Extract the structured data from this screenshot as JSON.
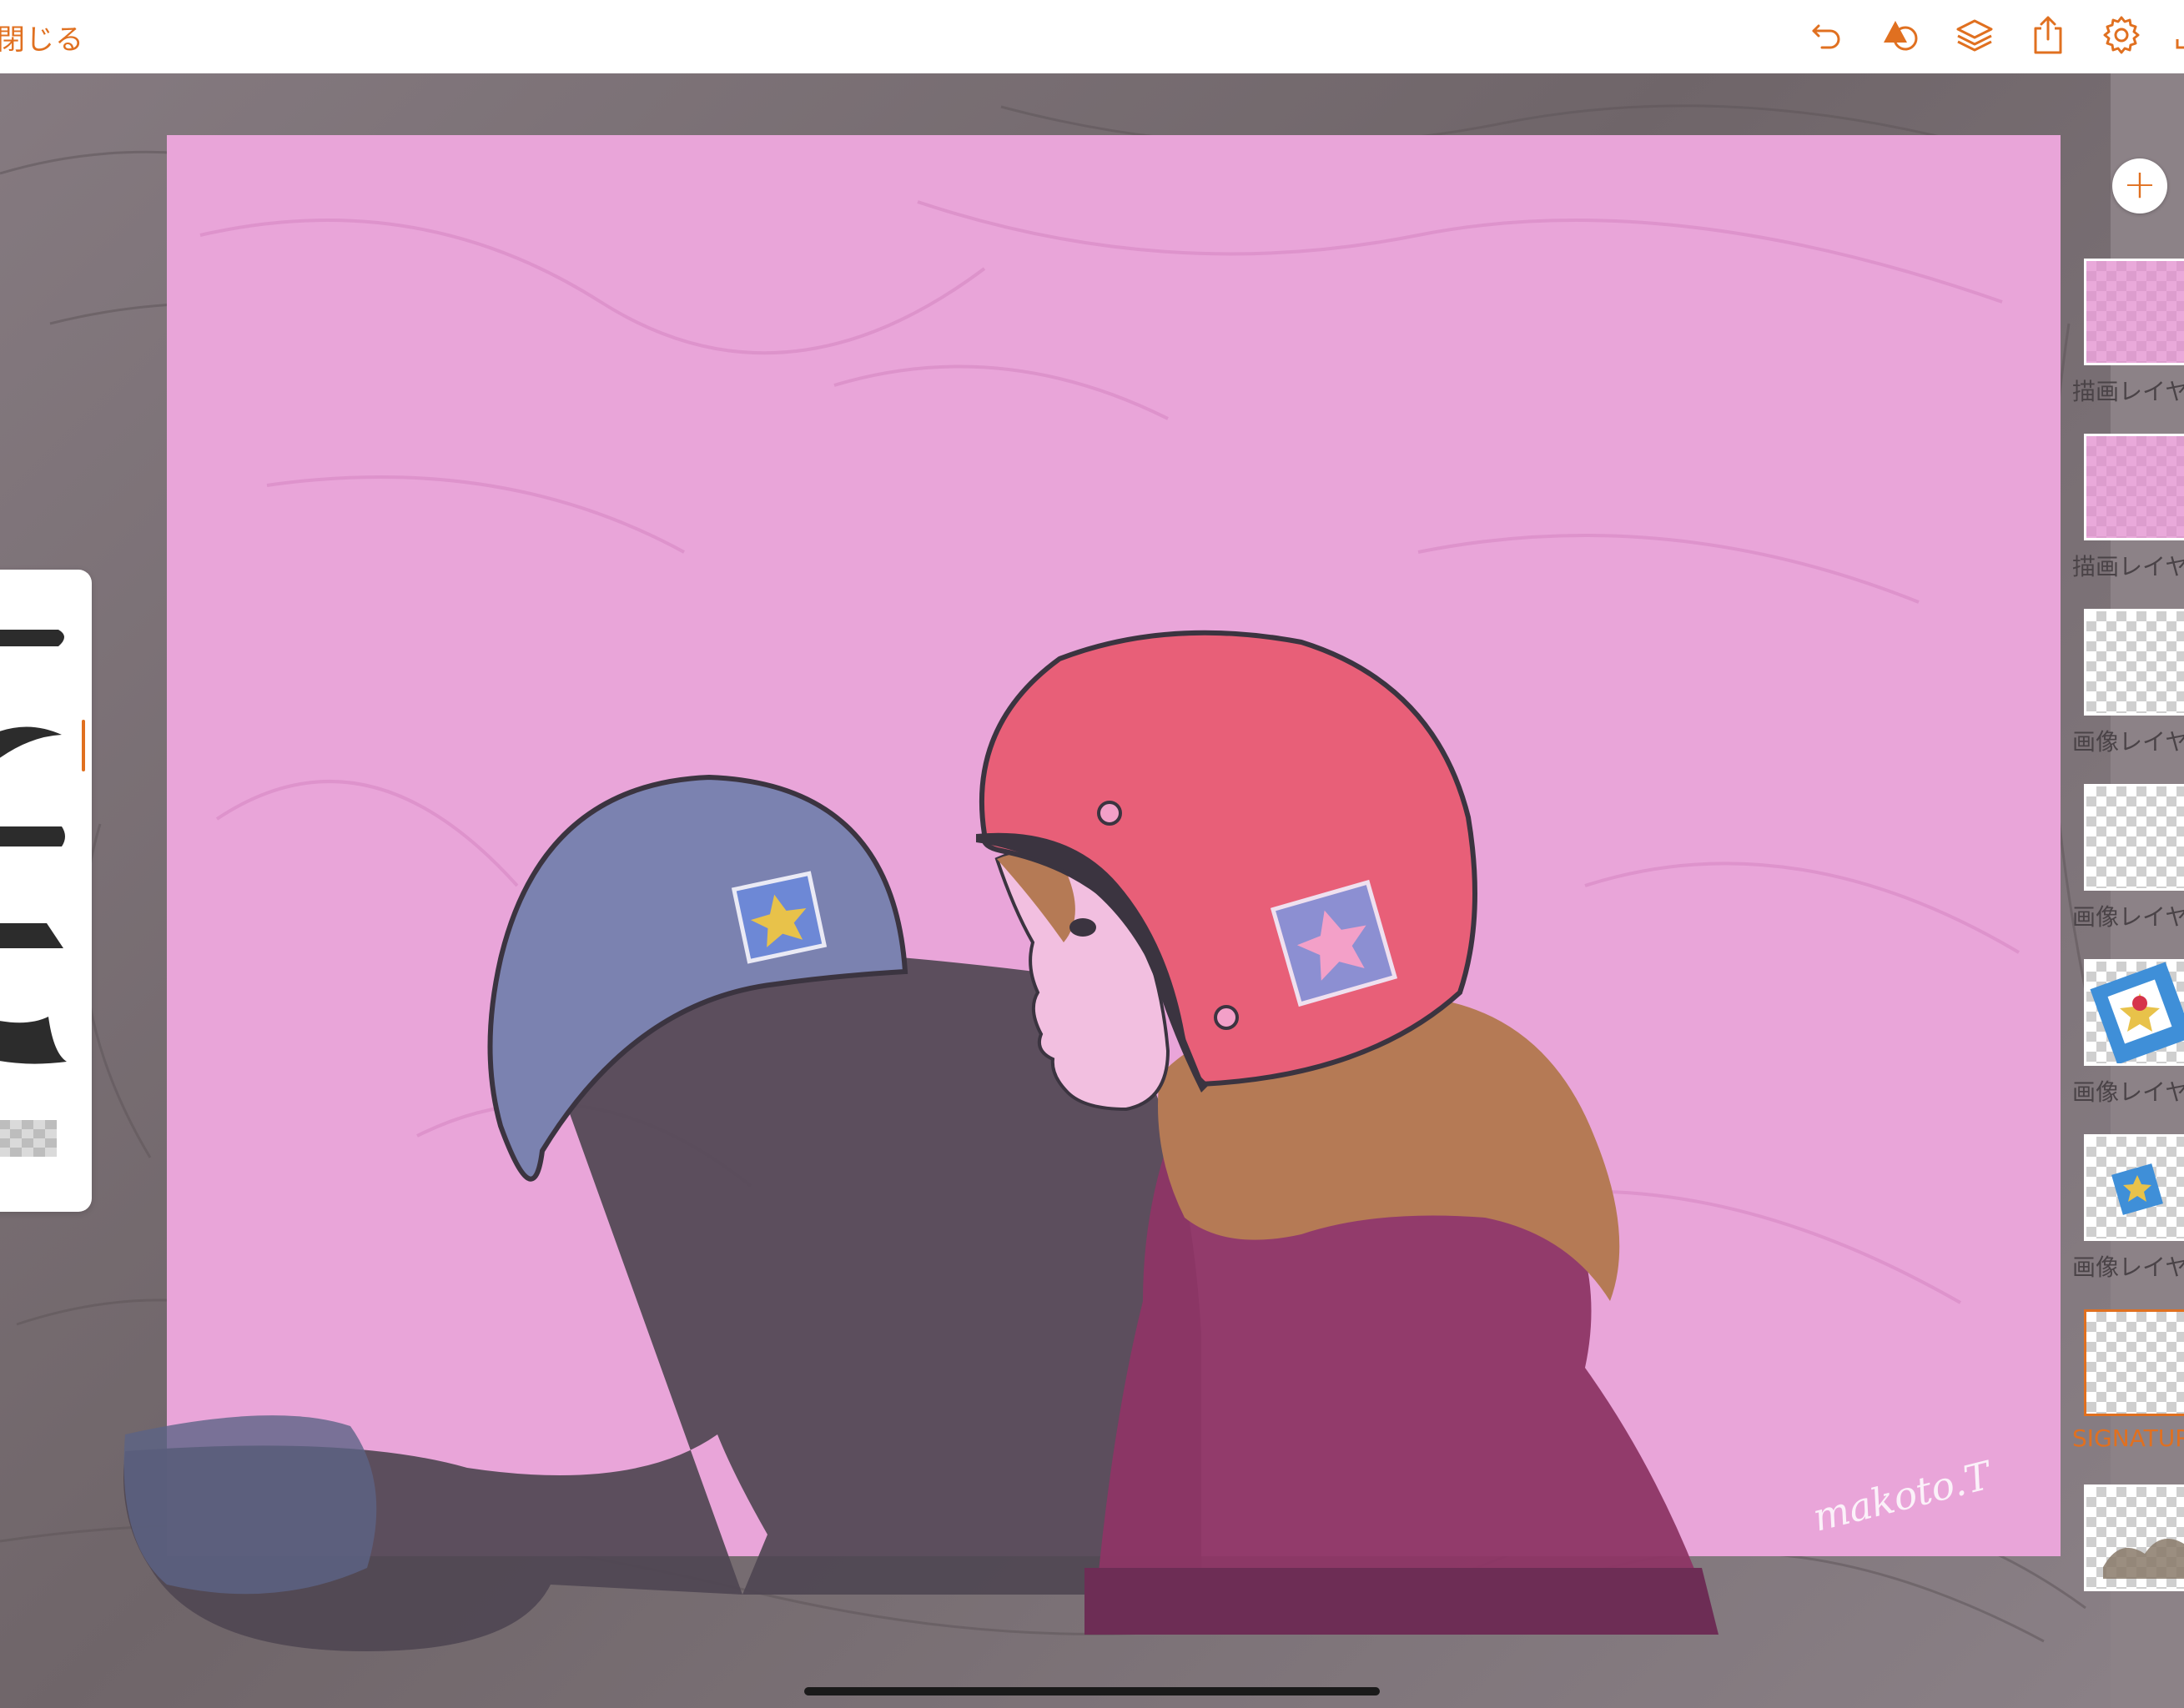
{
  "toolbar": {
    "close_label": "閉じる",
    "icons": [
      "undo-icon",
      "shapes-icon",
      "layers-icon",
      "share-icon",
      "settings-icon"
    ]
  },
  "signature_text": "makoto.T",
  "layers_panel": {
    "add_button_label": "+",
    "layers": [
      {
        "label": "描画レイヤー",
        "thumbnail": "pink-fill"
      },
      {
        "label": "描画レイヤー",
        "thumbnail": "pink-fill"
      },
      {
        "label": "画像レイヤー",
        "thumbnail": "empty"
      },
      {
        "label": "画像レイヤー",
        "thumbnail": "empty"
      },
      {
        "label": "画像レイヤー",
        "thumbnail": "sticker-large"
      },
      {
        "label": "画像レイヤー",
        "thumbnail": "sticker-small"
      },
      {
        "label": "SIGNATURE",
        "thumbnail": "empty",
        "selected": true
      },
      {
        "label": "",
        "thumbnail": "sketch"
      }
    ]
  },
  "colors": {
    "accent": "#e07020",
    "canvas_pink": "#e9a5d9",
    "helmet_red": "#e85f78",
    "helmet_blue": "#7b82b0"
  }
}
